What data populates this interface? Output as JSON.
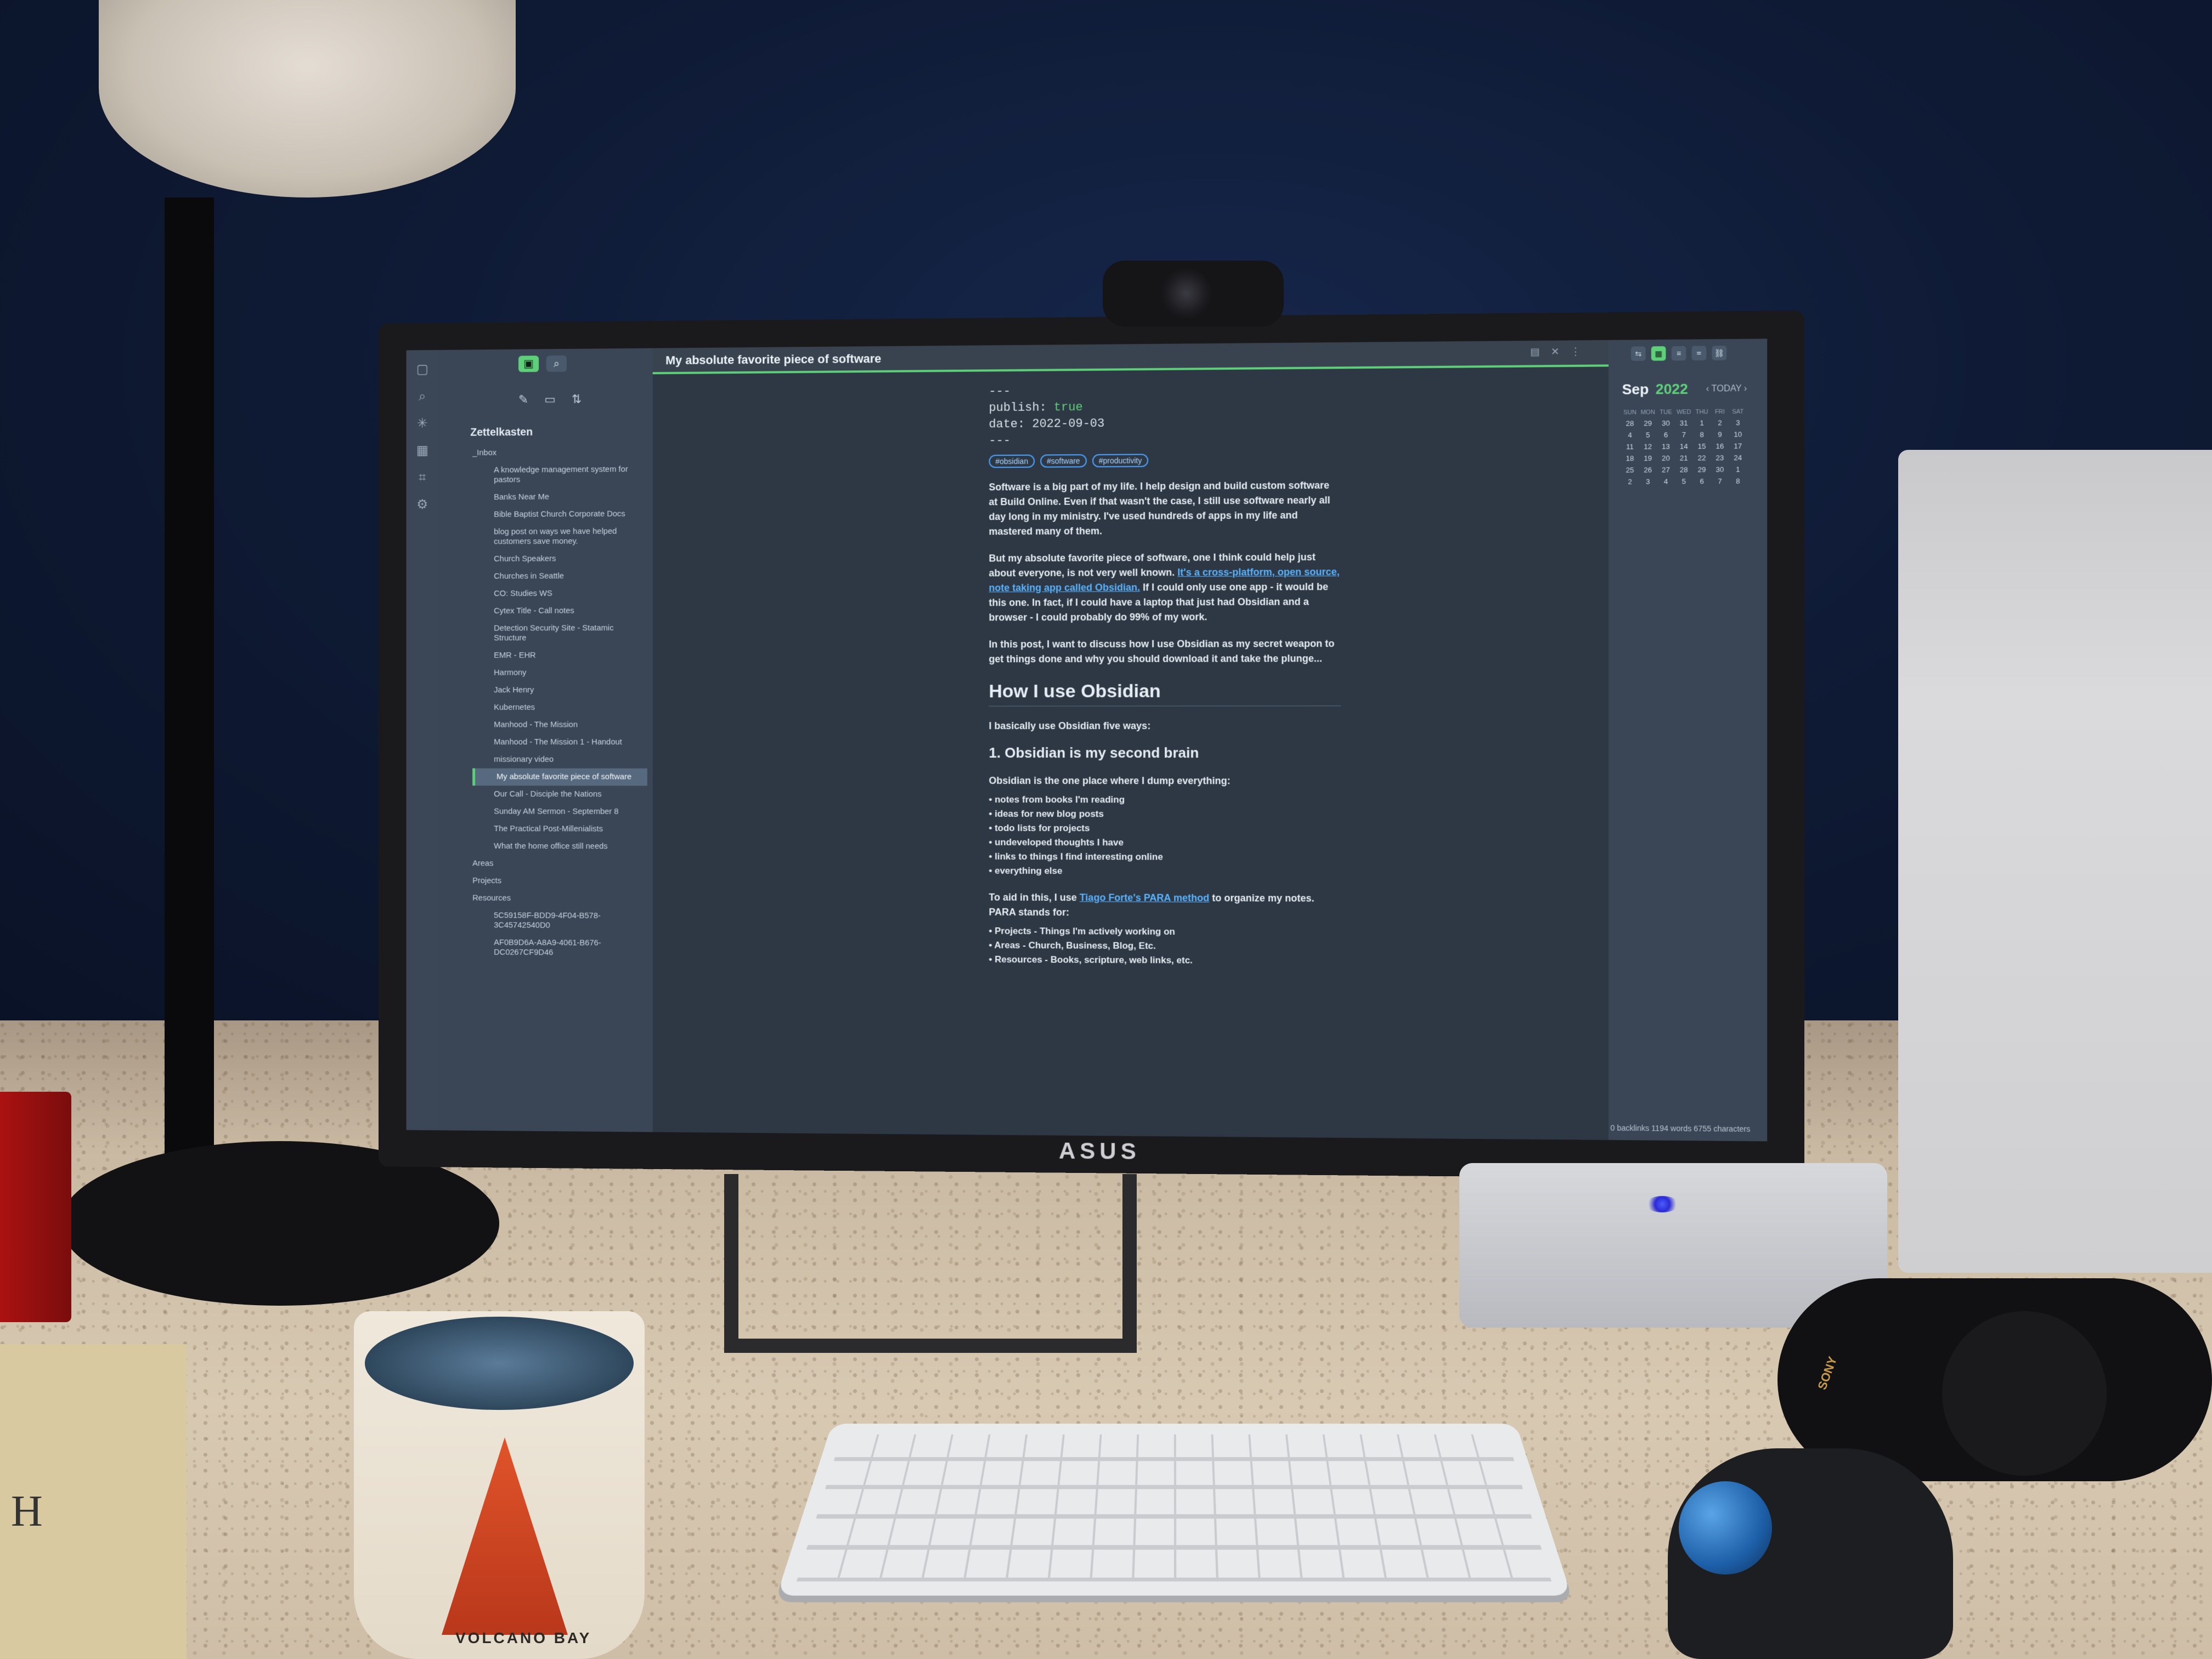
{
  "tab": {
    "title": "My absolute favorite piece of software"
  },
  "ribbon": {
    "icons": [
      "files-icon",
      "search-icon",
      "graph-icon",
      "calendar-icon",
      "tag-icon",
      "settings-icon"
    ]
  },
  "sidebar": {
    "vault_name": "Zettelkasten",
    "items": [
      {
        "label": "_Inbox",
        "type": "folder"
      },
      {
        "label": "A knowledge management system for pastors",
        "type": "file"
      },
      {
        "label": "Banks Near Me",
        "type": "file"
      },
      {
        "label": "Bible Baptist Church Corporate Docs",
        "type": "file"
      },
      {
        "label": "blog post on ways we have helped customers save money.",
        "type": "file"
      },
      {
        "label": "Church Speakers",
        "type": "file"
      },
      {
        "label": "Churches in Seattle",
        "type": "file"
      },
      {
        "label": "CO: Studies WS",
        "type": "file"
      },
      {
        "label": "Cytex Title - Call notes",
        "type": "file"
      },
      {
        "label": "Detection Security Site - Statamic Structure",
        "type": "file"
      },
      {
        "label": "EMR - EHR",
        "type": "file"
      },
      {
        "label": "Harmony",
        "type": "file"
      },
      {
        "label": "Jack Henry",
        "type": "file"
      },
      {
        "label": "Kubernetes",
        "type": "file"
      },
      {
        "label": "Manhood - The Mission",
        "type": "file"
      },
      {
        "label": "Manhood - The Mission 1 - Handout",
        "type": "file"
      },
      {
        "label": "missionary video",
        "type": "file"
      },
      {
        "label": "My absolute favorite piece of software",
        "type": "file",
        "active": true
      },
      {
        "label": "Our Call - Disciple the Nations",
        "type": "file"
      },
      {
        "label": "Sunday AM Sermon - September 8",
        "type": "file"
      },
      {
        "label": "The Practical Post-Millenialists",
        "type": "file"
      },
      {
        "label": "What the home office still needs",
        "type": "file"
      },
      {
        "label": "Areas",
        "type": "folder"
      },
      {
        "label": "Projects",
        "type": "folder"
      },
      {
        "label": "Resources",
        "type": "folder"
      },
      {
        "label": "5C59158F-BDD9-4F04-B578-3C45742540D0",
        "type": "file"
      },
      {
        "label": "AF0B9D6A-A8A9-4061-B676-DC0267CF9D46",
        "type": "file"
      }
    ]
  },
  "doc": {
    "fm_sep": "---",
    "fm_publish_key": "publish:",
    "fm_publish_val": "true",
    "fm_date_key": "date:",
    "fm_date_val": "2022-09-03",
    "tags": [
      "#obsidian",
      "#software",
      "#productivity"
    ],
    "p1": "Software is a big part of my life. I help design and build custom software at Build Online. Even if that wasn't the case, I still use software nearly all day long in my ministry. I've used hundreds of apps in my life and mastered many of them.",
    "p2_a": "But my absolute favorite piece of software, one I think could help just about everyone, is not very well known.",
    "p2_link": "It's a cross-platform, open source, note taking app called Obsidian.",
    "p2_b": "If I could only use one app - it would be this one. In fact, if I could have a laptop that just had Obsidian and a browser - I could probably do 99% of my work.",
    "p3": "In this post, I want to discuss how I use Obsidian as my secret weapon to get things done and why you should download it and take the plunge...",
    "h1": "How I use Obsidian",
    "p4": "I basically use Obsidian five ways:",
    "h2": "1. Obsidian is my second brain",
    "p5": "Obsidian is the one place where I dump everything:",
    "bullets": [
      "notes from books I'm reading",
      "ideas for new blog posts",
      "todo lists for projects",
      "undeveloped thoughts I have",
      "links to things I find interesting online",
      "everything else"
    ],
    "p6_a": "To aid in this, I use",
    "p6_link": "Tiago Forte's PARA method",
    "p6_b": "to organize my notes. PARA stands for:",
    "para": [
      "Projects - Things I'm actively working on",
      "Areas - Church, Business, Blog, Etc.",
      "Resources - Books, scripture, web links, etc."
    ]
  },
  "calendar": {
    "month": "Sep",
    "year": "2022",
    "today_label": "TODAY",
    "dow": [
      "SUN",
      "MON",
      "TUE",
      "WED",
      "THU",
      "FRI",
      "SAT"
    ],
    "days": [
      "28",
      "29",
      "30",
      "31",
      "1",
      "2",
      "3",
      "4",
      "5",
      "6",
      "7",
      "8",
      "9",
      "10",
      "11",
      "12",
      "13",
      "14",
      "15",
      "16",
      "17",
      "18",
      "19",
      "20",
      "21",
      "22",
      "23",
      "24",
      "25",
      "26",
      "27",
      "28",
      "29",
      "30",
      "1",
      "2",
      "3",
      "4",
      "5",
      "6",
      "7",
      "8"
    ]
  },
  "status": {
    "text": "0 backlinks   1194 words   6755 characters"
  },
  "hardware": {
    "monitor_brand": "ASUS",
    "mug_text": "VOLCANO BAY",
    "book_letter": "H",
    "headphone_brand": "SONY"
  }
}
